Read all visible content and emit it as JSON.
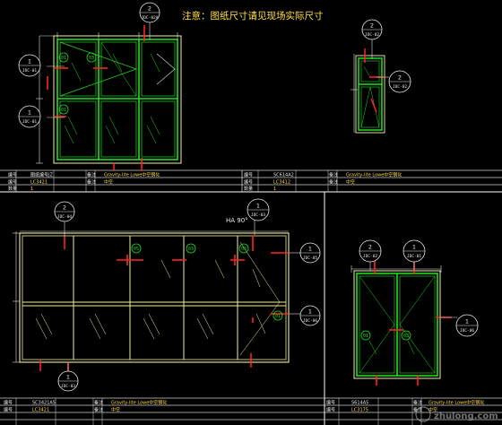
{
  "notice": "注意：图纸尺寸请见现场实际尺寸",
  "dimension_label": "HA 90°",
  "callouts": [
    {
      "id": "cb-1",
      "num": "2",
      "code": "JDC-02A"
    },
    {
      "id": "cb-2",
      "num": "1",
      "code": "JDC-01"
    },
    {
      "id": "cb-3",
      "num": "1",
      "code": "JDC-01"
    },
    {
      "id": "cb-4",
      "num": "2",
      "code": "JDC-02"
    },
    {
      "id": "cb-5",
      "num": "2",
      "code": "JDC-02"
    },
    {
      "id": "cb-6",
      "num": "2",
      "code": "JDC-04"
    },
    {
      "id": "cb-7",
      "num": "1",
      "code": "JDC-03"
    },
    {
      "id": "cb-8",
      "num": "1",
      "code": "JDC-05"
    },
    {
      "id": "cb-9",
      "num": "1",
      "code": "JDC-03"
    },
    {
      "id": "cb-10",
      "num": "1",
      "code": "JDC-06"
    },
    {
      "id": "cb-11",
      "num": "2",
      "code": "JDC-02"
    },
    {
      "id": "cb-12",
      "num": "1",
      "code": "JDC-01"
    },
    {
      "id": "cb-13",
      "num": "1",
      "code": "JDC-06"
    }
  ],
  "panel_tags": [
    "01",
    "03",
    "01",
    "05",
    "03",
    "03",
    "01",
    "01",
    "03"
  ],
  "title_blocks": {
    "top_left": {
      "r1": [
        "编号",
        "图纸编号JZ",
        "备注",
        "Gravity-lite Lowe中空钢化"
      ],
      "r2": [
        "编号",
        "LC3421",
        "备注",
        "中空"
      ],
      "r3": [
        "数量",
        "1"
      ]
    },
    "top_right": {
      "r1": [
        "编号",
        "SC614A2",
        "备注",
        "Gravity-lite Lowe中空钢化"
      ],
      "r2": [
        "编号",
        "LC3412",
        "备注",
        "中空"
      ],
      "r3": [
        "数量",
        "1"
      ]
    },
    "bot_left": {
      "r1": [
        "编号",
        "SC3421A5",
        "备注",
        "Gravity-lite Lowe中空钢化"
      ],
      "r2": [
        "编号",
        "LC3421",
        "备注",
        "中空"
      ]
    },
    "bot_right": {
      "r1": [
        "编号",
        "S614A5",
        "备注",
        "Gravity-lite Lowe中空钢化"
      ],
      "r2": [
        "编号",
        "LC3175",
        "备注",
        "中空"
      ]
    }
  },
  "watermark": "zhulong.com"
}
